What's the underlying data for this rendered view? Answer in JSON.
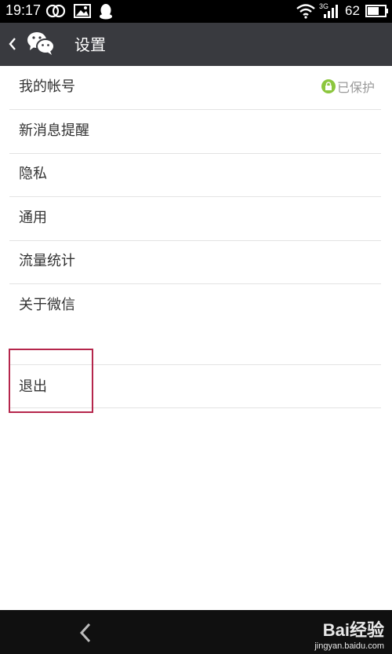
{
  "status_bar": {
    "time": "19:17",
    "signal_type": "3G",
    "battery": "62",
    "icons": [
      "infinity-icon",
      "image-icon",
      "qq-icon",
      "wifi-icon",
      "signal-icon",
      "battery-icon"
    ]
  },
  "header": {
    "title": "设置",
    "back_icon": "chevron-left-icon",
    "app_icon": "wechat-icon",
    "background": "#393a3f"
  },
  "settings": {
    "items": [
      {
        "label": "我的帐号",
        "badge": "已保护"
      },
      {
        "label": "新消息提醒"
      },
      {
        "label": "隐私"
      },
      {
        "label": "通用"
      },
      {
        "label": "流量统计"
      },
      {
        "label": "关于微信"
      }
    ],
    "logout": {
      "label": "退出"
    }
  },
  "annotation": {
    "color": "#b5264c"
  },
  "nav_bar": {
    "back_icon": "back-arrow-icon",
    "watermark_brand": "Bai经验",
    "watermark_url": "jingyan.baidu.com"
  }
}
